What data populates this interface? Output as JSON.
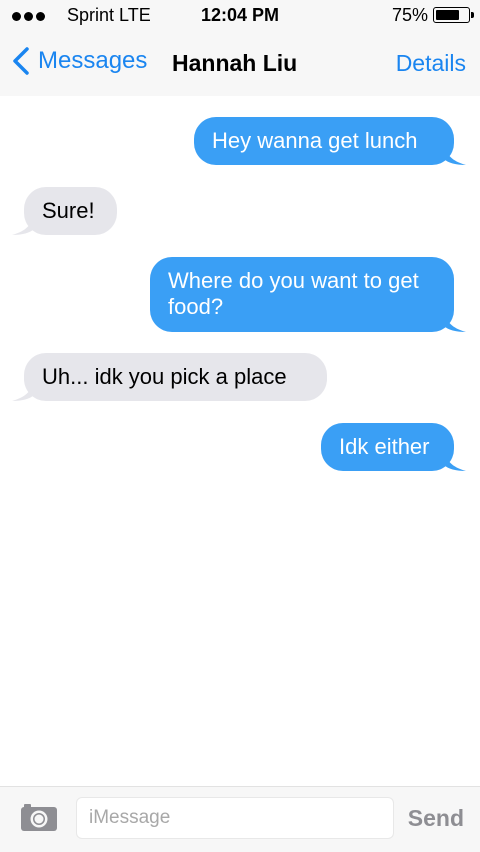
{
  "status_bar": {
    "carrier": "Sprint  LTE",
    "time": "12:04 PM",
    "battery_percent": "75%",
    "battery_level": 0.75,
    "signal_dots": 3
  },
  "nav": {
    "back_label": "Messages",
    "title": "Hannah Liu",
    "details_label": "Details",
    "accent_color": "#1a85f0"
  },
  "messages": [
    {
      "direction": "outgoing",
      "text": "Hey wanna get lunch"
    },
    {
      "direction": "incoming",
      "text": "Sure!"
    },
    {
      "direction": "outgoing",
      "text": "Where do you want to get food?"
    },
    {
      "direction": "incoming",
      "text": "Uh... idk you pick a place"
    },
    {
      "direction": "outgoing",
      "text": "Idk either"
    }
  ],
  "colors": {
    "outgoing_bubble": "#3a9ff5",
    "incoming_bubble": "#e6e6eb"
  },
  "input_bar": {
    "camera_icon": "camera-icon",
    "placeholder": "iMessage",
    "value": "",
    "send_label": "Send"
  }
}
